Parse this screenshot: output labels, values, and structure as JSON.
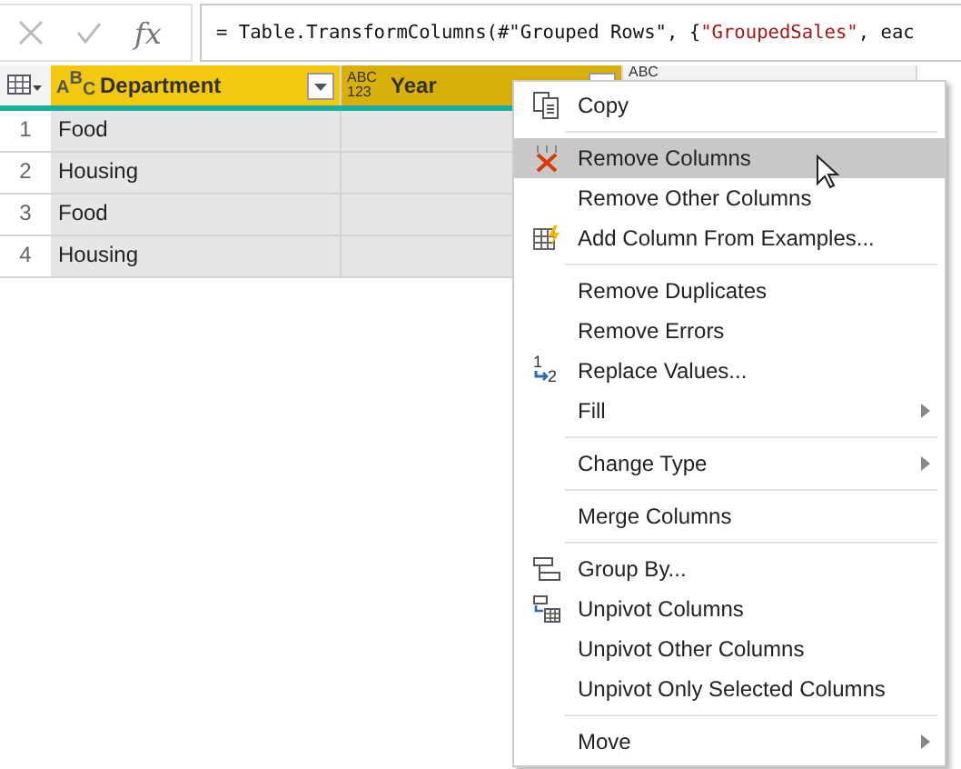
{
  "formula_bar": {
    "fx": "fx",
    "parts": [
      {
        "kind": "code",
        "text": "= Table.TransformColumns(#\"Grouped Rows\", {"
      },
      {
        "kind": "string",
        "text": "\"GroupedSales\""
      },
      {
        "kind": "code",
        "text": ", eac"
      }
    ]
  },
  "table": {
    "columns": [
      {
        "name": "Department",
        "type": {
          "kind": "staggered",
          "marks": [
            "A",
            "B",
            "C"
          ]
        },
        "selected": true,
        "hover": false
      },
      {
        "name": "Year",
        "type": {
          "kind": "stacked",
          "marks": [
            "ABC",
            "123"
          ]
        },
        "selected": true,
        "hover": true
      },
      {
        "type": {
          "kind": "stacked",
          "marks": [
            "ABC"
          ]
        },
        "selected": false,
        "hover": false
      }
    ],
    "rows": [
      {
        "index": "1",
        "cells": [
          "Food"
        ]
      },
      {
        "index": "2",
        "cells": [
          "Housing"
        ]
      },
      {
        "index": "3",
        "cells": [
          "Food"
        ]
      },
      {
        "index": "4",
        "cells": [
          "Housing"
        ]
      }
    ]
  },
  "context_menu": {
    "items": [
      {
        "kind": "copy",
        "label": "Copy",
        "selected": false,
        "submenu": false
      },
      {
        "kind": "separator"
      },
      {
        "kind": "remove",
        "label": "Remove Columns",
        "selected": true,
        "submenu": false
      },
      {
        "kind": "plain",
        "label": "Remove Other Columns",
        "selected": false,
        "submenu": false
      },
      {
        "kind": "examples",
        "label": "Add Column From Examples...",
        "selected": false,
        "submenu": false
      },
      {
        "kind": "separator"
      },
      {
        "kind": "plain",
        "label": "Remove Duplicates",
        "selected": false,
        "submenu": false
      },
      {
        "kind": "plain",
        "label": "Remove Errors",
        "selected": false,
        "submenu": false
      },
      {
        "kind": "replace",
        "label": "Replace Values...",
        "selected": false,
        "submenu": false,
        "icon_text": [
          "1",
          "2"
        ]
      },
      {
        "kind": "plain",
        "label": "Fill",
        "selected": false,
        "submenu": true
      },
      {
        "kind": "separator"
      },
      {
        "kind": "plain",
        "label": "Change Type",
        "selected": false,
        "submenu": true
      },
      {
        "kind": "separator"
      },
      {
        "kind": "plain",
        "label": "Merge Columns",
        "selected": false,
        "submenu": false
      },
      {
        "kind": "separator"
      },
      {
        "kind": "groupby",
        "label": "Group By...",
        "selected": false,
        "submenu": false
      },
      {
        "kind": "unpivot",
        "label": "Unpivot Columns",
        "selected": false,
        "submenu": false
      },
      {
        "kind": "plain",
        "label": "Unpivot Other Columns",
        "selected": false,
        "submenu": false
      },
      {
        "kind": "plain",
        "label": "Unpivot Only Selected Columns",
        "selected": false,
        "submenu": false
      },
      {
        "kind": "separator"
      },
      {
        "kind": "plain",
        "label": "Move",
        "selected": false,
        "submenu": true
      }
    ]
  }
}
